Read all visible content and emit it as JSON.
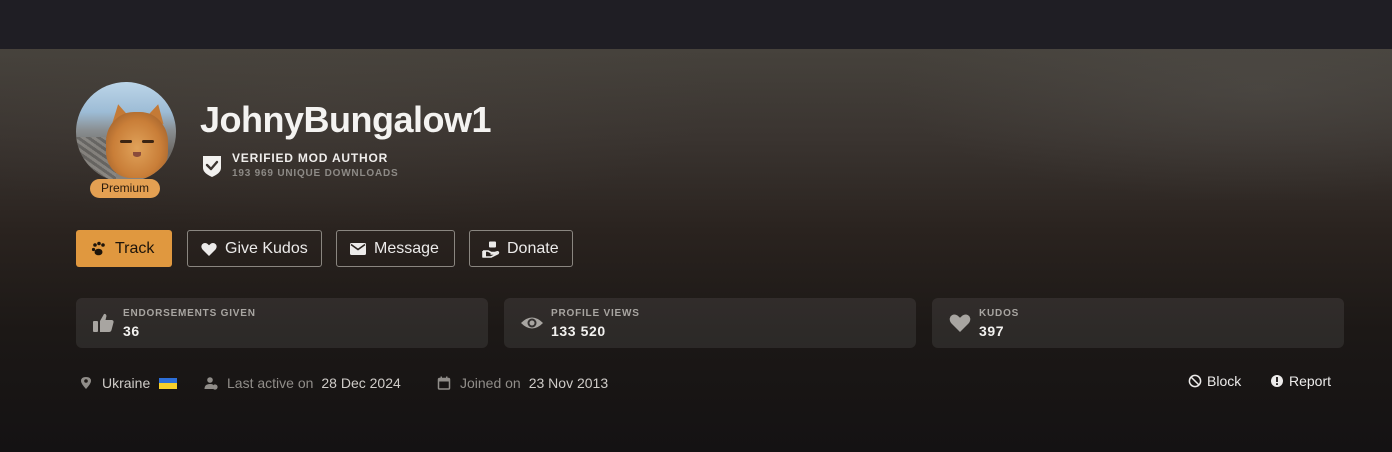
{
  "profile": {
    "username": "JohnyBungalow1",
    "badge": "Premium",
    "verified_title": "VERIFIED MOD AUTHOR",
    "verified_sub": "193 969 UNIQUE DOWNLOADS"
  },
  "actions": {
    "track": "Track",
    "kudos": "Give Kudos",
    "message": "Message",
    "donate": "Donate"
  },
  "stats": [
    {
      "label": "ENDORSEMENTS GIVEN",
      "value": "36",
      "icon": "thumbs-up-icon"
    },
    {
      "label": "PROFILE VIEWS",
      "value": "133 520",
      "icon": "eye-icon"
    },
    {
      "label": "KUDOS",
      "value": "397",
      "icon": "heart-icon"
    }
  ],
  "meta": {
    "location": "Ukraine",
    "last_active_label": "Last active on",
    "last_active": "28 Dec 2024",
    "joined_label": "Joined on",
    "joined": "23 Nov 2013"
  },
  "links": {
    "block": "Block",
    "report": "Report"
  },
  "colors": {
    "accent": "#e0983f",
    "premium": "#e4a052"
  }
}
